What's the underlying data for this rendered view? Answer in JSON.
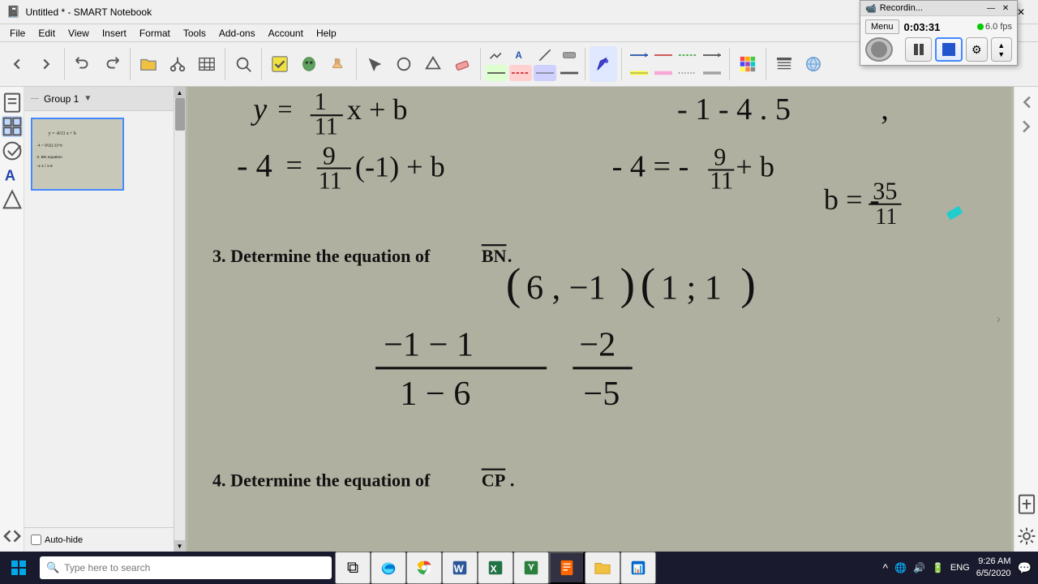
{
  "window": {
    "title": "Untitled * - SMART Notebook",
    "app_icon": "📓"
  },
  "titlebar": {
    "minimize_label": "—",
    "restore_label": "❐",
    "close_label": "✕"
  },
  "recording": {
    "title": "Recordin...",
    "menu_label": "Menu",
    "timer": "0:03:31",
    "fps": "6.0 fps",
    "minimize_label": "—",
    "close_label": "✕"
  },
  "menubar": {
    "items": [
      "File",
      "Edit",
      "View",
      "Insert",
      "Format",
      "Tools",
      "Add-ons",
      "Account",
      "Help"
    ]
  },
  "sidebar": {
    "group_label": "Group 1",
    "auto_hide_label": "Auto-hide"
  },
  "canvas": {
    "background_color": "#b0b0a0"
  },
  "taskbar": {
    "search_placeholder": "Type here to search",
    "apps": [
      {
        "name": "task-view",
        "icon": "⧉"
      },
      {
        "name": "edge",
        "icon": "🌐"
      },
      {
        "name": "chrome",
        "icon": "🔵"
      },
      {
        "name": "word",
        "icon": "W"
      },
      {
        "name": "unknown1",
        "icon": "📄"
      },
      {
        "name": "sticky-notes",
        "icon": "📝"
      },
      {
        "name": "unknown2",
        "icon": "👤"
      },
      {
        "name": "file-explorer",
        "icon": "📁"
      },
      {
        "name": "unknown3",
        "icon": "📊"
      }
    ],
    "tray": {
      "chevron": "^",
      "wifi": "📶",
      "volume": "🔊",
      "battery": "🔋",
      "lang": "ENG",
      "time": "9:26 AM",
      "date": "6/5/2020",
      "notification": "🔔"
    }
  }
}
